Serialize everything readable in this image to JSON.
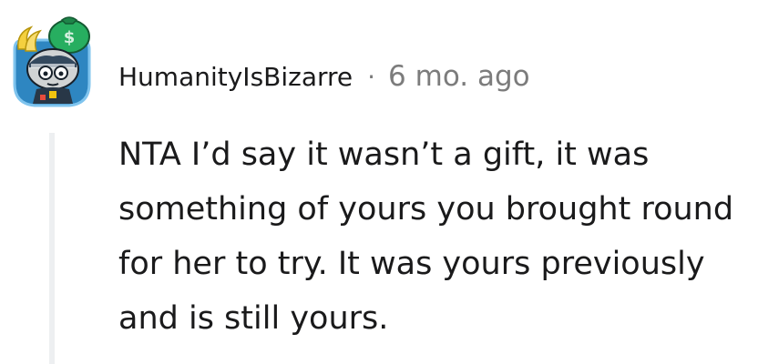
{
  "comment": {
    "username": "HumanityIsBizarre",
    "separator": "·",
    "age": "6 mo. ago",
    "body": "NTA I’d say it wasn’t a gift, it was something of yours you brought round for her to try. It was yours previously and is still yours."
  },
  "avatar": {
    "icon": "snoo-avatar-icon",
    "accessories": [
      "banana-icon",
      "money-bag-icon"
    ]
  },
  "colors": {
    "username": "#1a1a1b",
    "meta": "#7c7c7c",
    "thread_line": "#edeff1",
    "avatar_badge": "#2e86c1"
  }
}
